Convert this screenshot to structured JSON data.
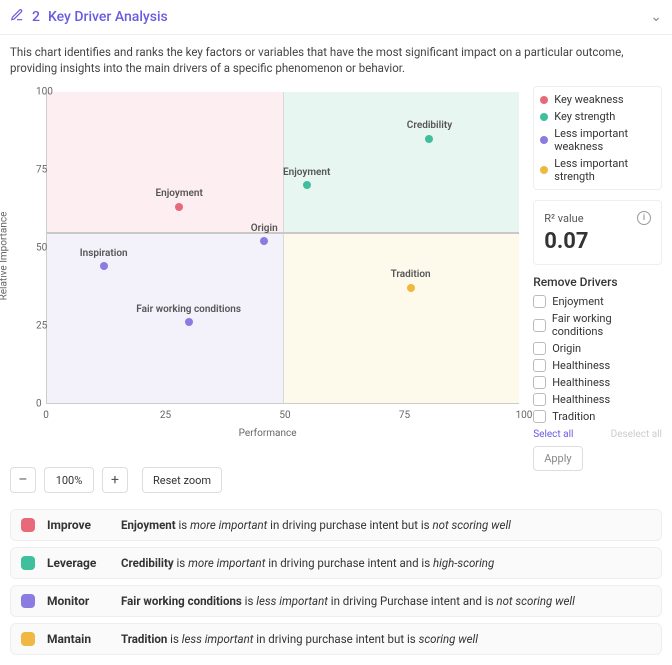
{
  "header": {
    "num": "2",
    "title": "Key Driver Analysis"
  },
  "description": "This chart identifies and ranks the key factors or variables that have the most significant impact on a particular outcome, providing insights into the main drivers of a specific phenomenon or behavior.",
  "legend": [
    {
      "label": "Key weakness",
      "color": "#e86a7a"
    },
    {
      "label": "Key strength",
      "color": "#3fbf9c"
    },
    {
      "label": "Less important weakness",
      "color": "#8a7ce0"
    },
    {
      "label": "Less important strength",
      "color": "#f0b840"
    }
  ],
  "r2": {
    "label": "R²  value",
    "value": "0.07"
  },
  "remove": {
    "title": "Remove Drivers",
    "items": [
      "Enjoyment",
      "Fair working conditions",
      "Origin",
      "Healthiness",
      "Healthiness",
      "Healthiness",
      "Tradition"
    ],
    "select_all": "Select all",
    "deselect_all": "Deselect all",
    "apply": "Apply"
  },
  "chart_data": {
    "type": "scatter",
    "xlabel": "Performance",
    "ylabel": "Relative Importance",
    "xlim": [
      0,
      100
    ],
    "ylim": [
      0,
      100
    ],
    "x_ticks": [
      0,
      25,
      50,
      75,
      100
    ],
    "y_ticks": [
      0,
      25,
      50,
      75,
      100
    ],
    "quadrant_split": {
      "x": 50,
      "y": 55
    },
    "series": [
      {
        "name": "Key weakness",
        "color": "#e86a7a",
        "points": [
          {
            "label": "Enjoyment",
            "x": 28,
            "y": 63
          }
        ]
      },
      {
        "name": "Key strength",
        "color": "#3fbf9c",
        "points": [
          {
            "label": "Credibility",
            "x": 81,
            "y": 85
          },
          {
            "label": "Enjoyment",
            "x": 55,
            "y": 70
          }
        ]
      },
      {
        "name": "Less important weakness",
        "color": "#8a7ce0",
        "points": [
          {
            "label": "Inspiration",
            "x": 12,
            "y": 44
          },
          {
            "label": "Origin",
            "x": 46,
            "y": 52
          },
          {
            "label": "Fair working conditions",
            "x": 30,
            "y": 26
          }
        ]
      },
      {
        "name": "Less important strength",
        "color": "#f0b840",
        "points": [
          {
            "label": "Tradition",
            "x": 77,
            "y": 37
          }
        ]
      }
    ]
  },
  "zoom": {
    "minus": "–",
    "plus": "+",
    "value": "100%",
    "reset": "Reset zoom"
  },
  "insights": [
    {
      "color": "#e86a7a",
      "label": "Improve",
      "subject": "Enjoyment",
      "mid1": " is ",
      "em1": "more important",
      "mid2": " in driving purchase intent but is ",
      "em2": "not scoring well"
    },
    {
      "color": "#3fbf9c",
      "label": "Leverage",
      "subject": "Credibility",
      "mid1": " is ",
      "em1": "more important",
      "mid2": " in driving purchase intent and is ",
      "em2": "high-scoring"
    },
    {
      "color": "#8a7ce0",
      "label": "Monitor",
      "subject": "Fair working conditions",
      "mid1": " is ",
      "em1": "less important",
      "mid2": " in driving Purchase intent and is ",
      "em2": "not scoring well"
    },
    {
      "color": "#f0b840",
      "label": "Mantain",
      "subject": "Tradition",
      "mid1": " is ",
      "em1": "less important",
      "mid2": " in driving purchase intent but is ",
      "em2": "scoring well"
    }
  ]
}
